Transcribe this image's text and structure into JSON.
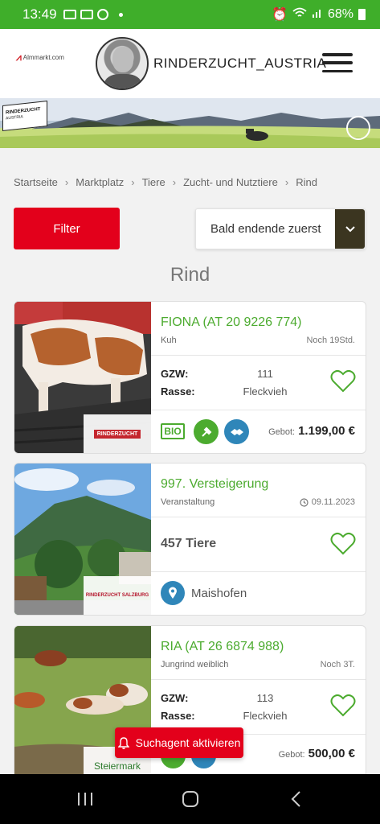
{
  "status_bar": {
    "time": "13:49",
    "battery": "68%"
  },
  "header": {
    "brand_small": "Almmarkt.com",
    "title": "RINDERZUCHT_AUSTRIA"
  },
  "banner": {
    "logo_line1": "RINDERZUCHT",
    "logo_line2": "AUSTRIA"
  },
  "breadcrumb": [
    "Startseite",
    "Marktplatz",
    "Tiere",
    "Zucht- und Nutztiere",
    "Rind"
  ],
  "filter": {
    "label": "Filter"
  },
  "sort": {
    "selected": "Bald endende zuerst"
  },
  "page_title": "Rind",
  "cards": [
    {
      "name": "FIONA (AT 20 9226 774)",
      "type": "Kuh",
      "time": "Noch 19Std.",
      "gzw_label": "GZW:",
      "gzw": "111",
      "rasse_label": "Rasse:",
      "rasse": "Fleckvieh",
      "bio": "BIO",
      "offer_label": "Gebot:",
      "offer": "1.199,00 €",
      "logo": "RINDERZUCHT"
    },
    {
      "name": "997. Versteigerung",
      "type": "Veranstaltung",
      "date": "09.11.2023",
      "count": "457 Tiere",
      "location": "Maishofen",
      "logo": "RINDERZUCHT SALZBURG"
    },
    {
      "name": "RIA (AT 26 6874 988)",
      "type": "Jungrind weiblich",
      "time": "Noch 3T.",
      "gzw_label": "GZW:",
      "gzw": "113",
      "rasse_label": "Rasse:",
      "rasse": "Fleckvieh",
      "offer_label": "Gebot:",
      "offer": "500,00 €",
      "logo": "Steiermark"
    }
  ],
  "agent_button": {
    "label": "Suchagent aktivieren"
  },
  "colors": {
    "accent_green": "#4cab2f",
    "status_green": "#3fae2a",
    "red": "#e3001b",
    "blue": "#2f86b9"
  }
}
